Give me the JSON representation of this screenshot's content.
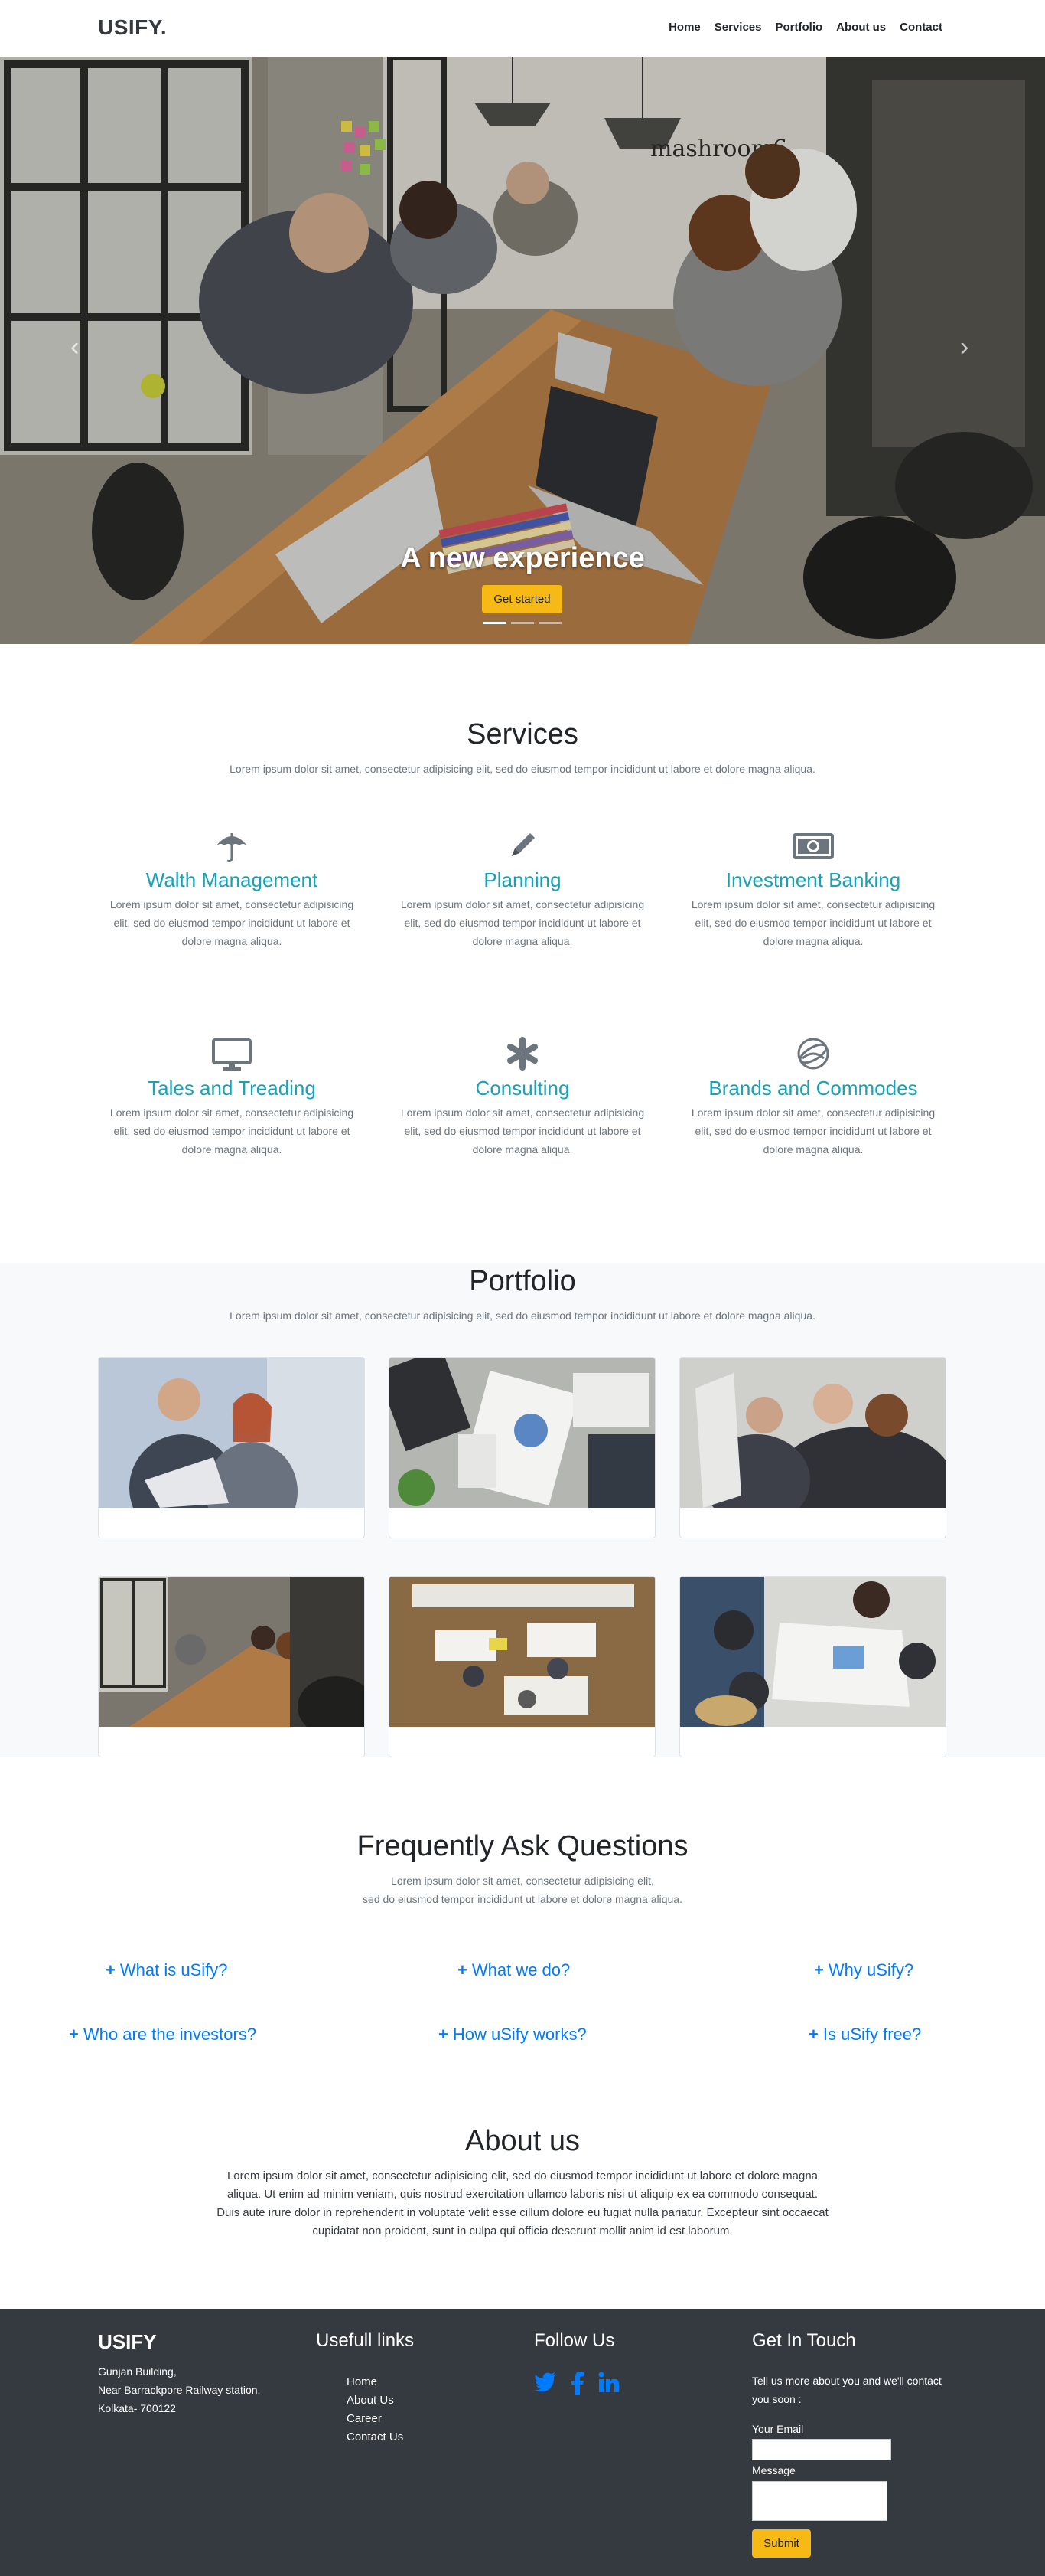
{
  "navbar": {
    "brand": "USIFY.",
    "links": [
      "Home",
      "Services",
      "Portfolio",
      "About us",
      "Contact"
    ]
  },
  "hero": {
    "caption": "A new experience",
    "button_label": "Get started",
    "wall_sign": "mashroom6",
    "slides_count": 3,
    "active_slide": 1,
    "prev_icon": "chevron-left-icon",
    "next_icon": "chevron-right-icon"
  },
  "services": {
    "title": "Services",
    "subtitle": "Lorem ipsum dolor sit amet, consectetur adipisicing elit, sed do eiusmod tempor incididunt ut labore et dolore magna aliqua.",
    "items": [
      {
        "title": "Walth Management",
        "icon": "umbrella-icon",
        "desc": "Lorem ipsum dolor sit amet, consectetur adipisicing elit, sed do eiusmod tempor incididunt ut labore et dolore magna aliqua."
      },
      {
        "title": "Planning",
        "icon": "pencil-icon",
        "desc": "Lorem ipsum dolor sit amet, consectetur adipisicing elit, sed do eiusmod tempor incididunt ut labore et dolore magna aliqua."
      },
      {
        "title": "Investment Banking",
        "icon": "money-icon",
        "desc": "Lorem ipsum dolor sit amet, consectetur adipisicing elit, sed do eiusmod tempor incididunt ut labore et dolore magna aliqua."
      },
      {
        "title": "Tales and Treading",
        "icon": "desktop-icon",
        "desc": "Lorem ipsum dolor sit amet, consectetur adipisicing elit, sed do eiusmod tempor incididunt ut labore et dolore magna aliqua."
      },
      {
        "title": "Consulting",
        "icon": "asterisk-icon",
        "desc": "Lorem ipsum dolor sit amet, consectetur adipisicing elit, sed do eiusmod tempor incididunt ut labore et dolore magna aliqua."
      },
      {
        "title": "Brands and Commodes",
        "icon": "globe-icon",
        "desc": "Lorem ipsum dolor sit amet, consectetur adipisicing elit, sed do eiusmod tempor incididunt ut labore et dolore magna aliqua."
      }
    ],
    "accent": "#17a2b8",
    "icon_color": "#6c757d"
  },
  "portfolio": {
    "title": "Portfolio",
    "subtitle": "Lorem ipsum dolor sit amet, consectetur adipisicing elit, sed do eiusmod tempor incididunt ut labore et dolore magna aliqua."
  },
  "faq": {
    "title": "Frequently Ask Questions",
    "subtitle_line1": "Lorem ipsum dolor sit amet, consectetur adipisicing elit,",
    "subtitle_line2": "sed do eiusmod tempor incididunt ut labore et dolore magna aliqua.",
    "questions": [
      "What is uSify?",
      "What we do?",
      "Why uSify?",
      "Who are the investors?",
      "How uSify works?",
      "Is uSify free?"
    ],
    "plus": "+",
    "link_color": "#007bff"
  },
  "about": {
    "title": "About us",
    "text": "Lorem ipsum dolor sit amet, consectetur adipisicing elit, sed do eiusmod tempor incididunt ut labore et dolore magna aliqua. Ut enim ad minim veniam, quis nostrud exercitation ullamco laboris nisi ut aliquip ex ea commodo consequat. Duis aute irure dolor in reprehenderit in voluptate velit esse cillum dolore eu fugiat nulla pariatur. Excepteur sint occaecat cupidatat non proident, sunt in culpa qui officia deserunt mollit anim id est laborum."
  },
  "footer": {
    "brand": "USIFY",
    "address": [
      "Gunjan Building,",
      "Near Barrackpore Railway station,",
      "Kolkata- 700122"
    ],
    "links_title": "Usefull links",
    "links": [
      "Home",
      "About Us",
      "Career",
      "Contact Us"
    ],
    "follow_title": "Follow Us",
    "social_icons": [
      "twitter-icon",
      "facebook-icon",
      "linkedin-icon"
    ],
    "touch_title": "Get In Touch",
    "touch_text": "Tell us more about you and we'll contact you soon :",
    "email_label": "Your Email",
    "message_label": "Message",
    "submit_label": "Submit",
    "bg": "#343a40"
  },
  "colors": {
    "brand_yellow": "#f6b915"
  }
}
